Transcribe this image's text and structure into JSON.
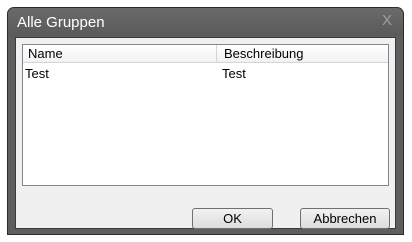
{
  "window": {
    "title": "Alle Gruppen",
    "close_glyph": "X"
  },
  "list": {
    "columns": [
      "Name",
      "Beschreibung"
    ],
    "rows": [
      {
        "name": "Test",
        "description": "Test"
      }
    ]
  },
  "buttons": {
    "ok_label": "OK",
    "cancel_label": "Abbrechen"
  }
}
